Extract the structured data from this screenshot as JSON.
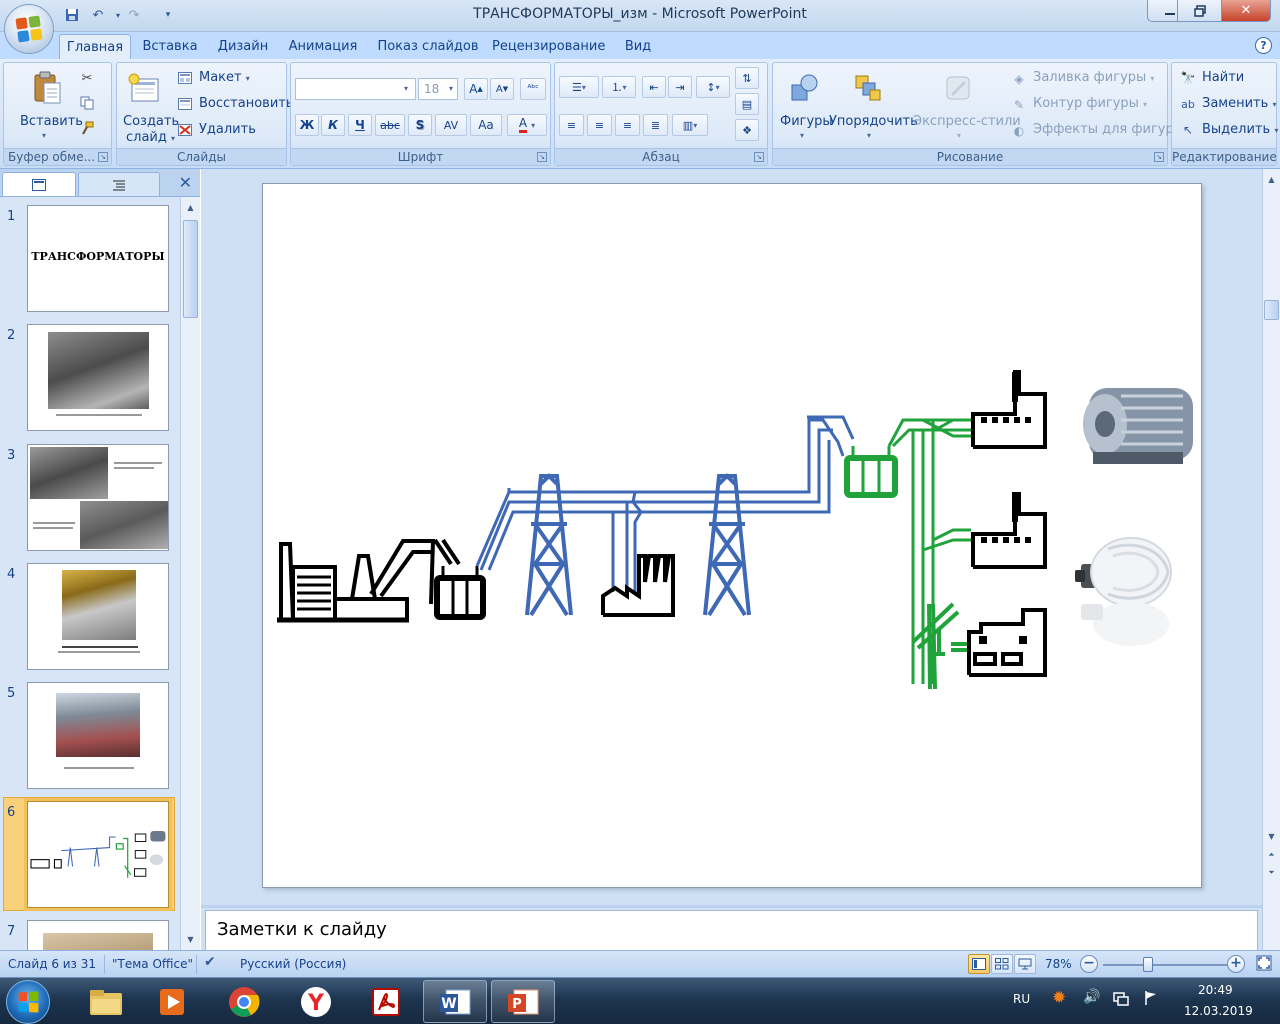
{
  "window": {
    "title": "ТРАНСФОРМАТОРЫ_изм - Microsoft PowerPoint"
  },
  "tabs": [
    "Главная",
    "Вставка",
    "Дизайн",
    "Анимация",
    "Показ слайдов",
    "Рецензирование",
    "Вид"
  ],
  "active_tab": "Главная",
  "ribbon": {
    "clipboard": {
      "label": "Буфер обме...",
      "paste": "Вставить"
    },
    "slides": {
      "label": "Слайды",
      "new_slide_1": "Создать",
      "new_slide_2": "слайд",
      "layout": "Макет",
      "reset": "Восстановить",
      "delete": "Удалить"
    },
    "font": {
      "label": "Шрифт",
      "font_name": "",
      "font_size": "18",
      "bold": "Ж",
      "italic": "К",
      "underline": "Ч",
      "strike": "abc",
      "shadow": "S",
      "spacing": "AV",
      "case": "Aa",
      "color": "A"
    },
    "paragraph": {
      "label": "Абзац"
    },
    "drawing": {
      "label": "Рисование",
      "shapes": "Фигуры",
      "arrange": "Упорядочить",
      "quick_styles": "Экспресс-стили",
      "fill": "Заливка фигуры",
      "outline": "Контур фигуры",
      "effects": "Эффекты для фигур"
    },
    "editing": {
      "label": "Редактирование",
      "find": "Найти",
      "replace": "Заменить",
      "select": "Выделить"
    }
  },
  "slides_panel": {
    "numbers": [
      "1",
      "2",
      "3",
      "4",
      "5",
      "6",
      "7"
    ],
    "slide1_title": "ТРАНСФОРМАТОРЫ",
    "selected": 6
  },
  "notes": {
    "placeholder": "Заметки к слайду"
  },
  "status": {
    "slide_pos": "Слайд 6 из 31",
    "theme": "\"Тема Office\"",
    "language": "Русский (Россия)",
    "zoom": "78%",
    "zoom_level": 0.78
  },
  "taskbar": {
    "lang": "RU",
    "time": "20:49",
    "date": "12.03.2019"
  },
  "colors": {
    "ribbon_bg": "#dbe7f8",
    "hv_line": "#3f68b5",
    "lv_line": "#1fa33a",
    "black_line": "#000000"
  }
}
